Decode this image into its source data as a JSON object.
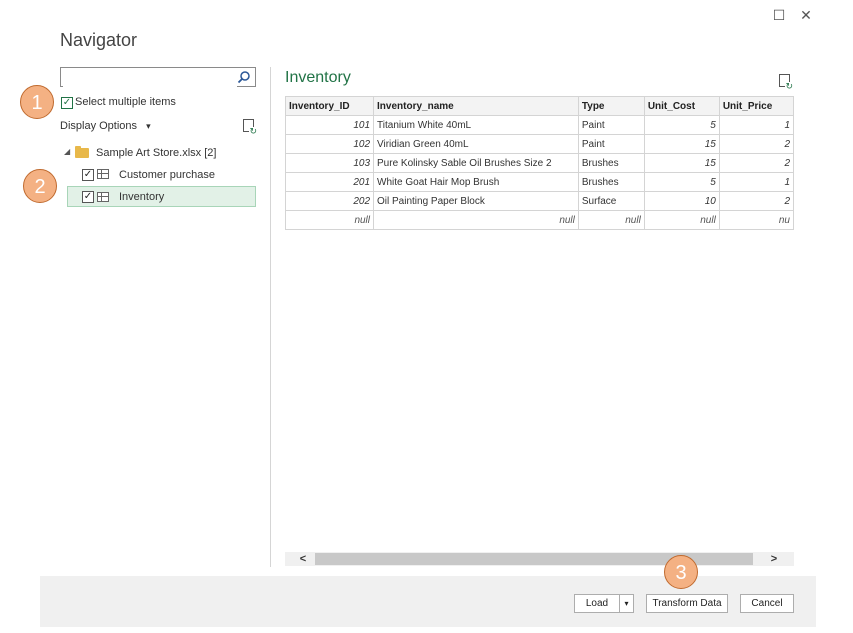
{
  "window": {
    "title": "Navigator",
    "maximize_glyph": "☐",
    "close_glyph": "✕"
  },
  "search": {
    "placeholder": "",
    "value": ""
  },
  "badges": [
    "1",
    "2",
    "3"
  ],
  "options": {
    "select_multiple_label": "Select multiple items",
    "display_options_label": "Display Options",
    "display_options_caret": "▾"
  },
  "tree": {
    "root_label": "Sample Art Store.xlsx [2]",
    "items": [
      {
        "label": "Customer purchase",
        "checked": true
      },
      {
        "label": "Inventory",
        "checked": true,
        "selected": true
      }
    ]
  },
  "preview": {
    "title": "Inventory",
    "columns": [
      "Inventory_ID",
      "Inventory_name",
      "Type",
      "Unit_Cost",
      "Unit_Price"
    ],
    "rows": [
      [
        "101",
        "Titanium White 40mL",
        "Paint",
        "5",
        "1"
      ],
      [
        "102",
        "Viridian Green 40mL",
        "Paint",
        "15",
        "2"
      ],
      [
        "103",
        "Pure Kolinsky Sable Oil Brushes Size 2",
        "Brushes",
        "15",
        "2"
      ],
      [
        "201",
        "White Goat Hair Mop Brush",
        "Brushes",
        "5",
        "1"
      ],
      [
        "202",
        "Oil Painting Paper Block",
        "Surface",
        "10",
        "2"
      ],
      [
        "null",
        "null",
        "null",
        "null",
        "nu"
      ]
    ]
  },
  "footer": {
    "load_label": "Load",
    "load_dropdown": "▾",
    "transform_label": "Transform Data",
    "cancel_label": "Cancel"
  },
  "colors": {
    "accent": "#217346",
    "badge_fill": "#f4b183",
    "selection": "#e2f1e7"
  }
}
